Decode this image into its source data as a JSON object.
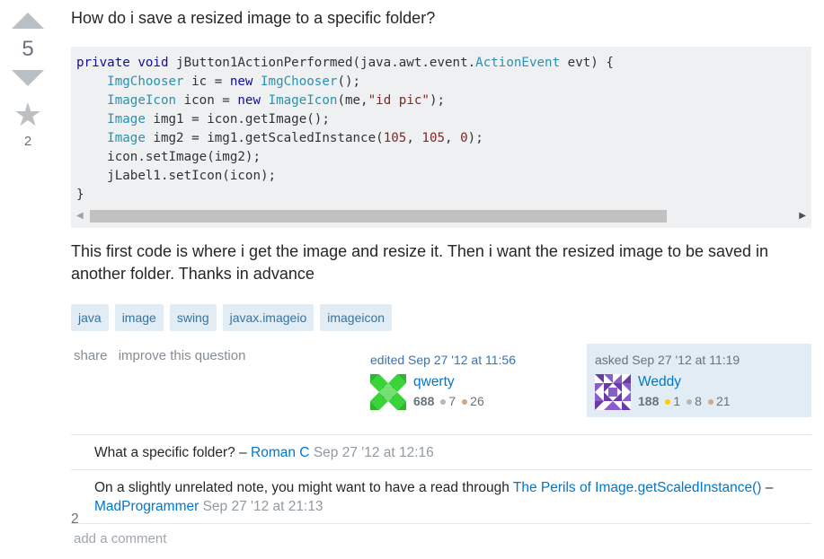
{
  "vote": {
    "score": "5",
    "favorites": "2"
  },
  "question": {
    "title": "How do i save a resized image to a specific folder?",
    "code_lines": [
      "private void jButton1ActionPerformed(java.awt.event.ActionEvent evt) {",
      "    ImgChooser ic = new ImgChooser();",
      "    ImageIcon icon = new ImageIcon(me,\"id pic\");",
      "    Image img1 = icon.getImage();",
      "    Image img2 = img1.getScaledInstance(105, 105, 0);",
      "    icon.setImage(img2);",
      "    jLabel1.setIcon(icon);",
      "}"
    ],
    "body": "This first code is where i get the image and resize it. Then i want the resized image to be saved in another folder. Thanks in advance",
    "tags": [
      "java",
      "image",
      "swing",
      "javax.imageio",
      "imageicon"
    ]
  },
  "menu": {
    "share": "share",
    "improve": "improve this question"
  },
  "editor": {
    "action": "edited Sep 27 '12 at 11:56",
    "name": "qwerty",
    "rep": "688",
    "silver": "7",
    "bronze": "26"
  },
  "asker": {
    "action": "asked Sep 27 '12 at 11:19",
    "name": "Weddy",
    "rep": "188",
    "gold": "1",
    "silver": "8",
    "bronze": "21"
  },
  "comments": [
    {
      "score": "",
      "text": "What a specific folder? – ",
      "link": "",
      "text_after": "",
      "user": "Roman C",
      "date": "Sep 27 '12 at 12:16"
    },
    {
      "score": "2",
      "text": "On a slightly unrelated note, you might want to have a read through ",
      "link": "The Perils of Image.getScaledInstance()",
      "text_after": " – ",
      "user": "MadProgrammer",
      "date": "Sep 27 '12 at 21:13"
    }
  ],
  "add_comment": "add a comment",
  "colors": {
    "tag_bg": "#e1ecf4",
    "tag_fg": "#39739d",
    "link": "#0077cc",
    "owner_bg": "#e1ecf4",
    "gold": "#ffcc01",
    "silver": "#b4b8bc",
    "bronze": "#d1a684"
  }
}
